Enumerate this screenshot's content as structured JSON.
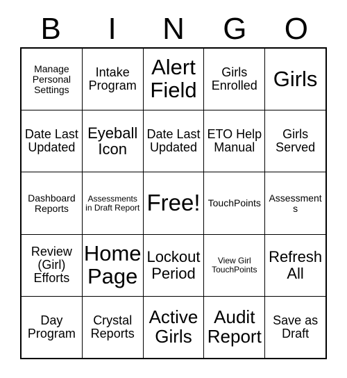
{
  "card": {
    "title_letters": [
      "B",
      "I",
      "N",
      "G",
      "O"
    ],
    "free_space_label": "Free!",
    "ink_color": "#000000",
    "background_color": "#ffffff",
    "grid": {
      "columns": 5,
      "rows": 5,
      "cells": [
        [
          {
            "text": "Manage Personal Settings",
            "size": "sm"
          },
          {
            "text": "Intake Program",
            "size": "md"
          },
          {
            "text": "Alert Field",
            "size": "xxl"
          },
          {
            "text": "Girls Enrolled",
            "size": "md"
          },
          {
            "text": "Girls",
            "size": "xxl"
          }
        ],
        [
          {
            "text": "Date Last Updated",
            "size": "md"
          },
          {
            "text": "Eyeball Icon",
            "size": "lg"
          },
          {
            "text": "Date Last Updated",
            "size": "md"
          },
          {
            "text": "ETO Help Manual",
            "size": "md"
          },
          {
            "text": "Girls Served",
            "size": "md"
          }
        ],
        [
          {
            "text": "Dashboard Reports",
            "size": "sm"
          },
          {
            "text": "Assessments in Draft Report",
            "size": "xs"
          },
          {
            "text": "Free!",
            "size": "free"
          },
          {
            "text": "TouchPoints",
            "size": "sm"
          },
          {
            "text": "Assessments",
            "size": "sm"
          }
        ],
        [
          {
            "text": "Review (Girl) Efforts",
            "size": "md"
          },
          {
            "text": "Home Page",
            "size": "xxl"
          },
          {
            "text": "Lockout Period",
            "size": "lg"
          },
          {
            "text": "View Girl TouchPoints",
            "size": "xs"
          },
          {
            "text": "Refresh All",
            "size": "lg"
          }
        ],
        [
          {
            "text": "Day Program",
            "size": "md"
          },
          {
            "text": "Crystal Reports",
            "size": "md"
          },
          {
            "text": "Active Girls",
            "size": "xl"
          },
          {
            "text": "Audit Report",
            "size": "xl"
          },
          {
            "text": "Save as Draft",
            "size": "md"
          }
        ]
      ]
    }
  }
}
